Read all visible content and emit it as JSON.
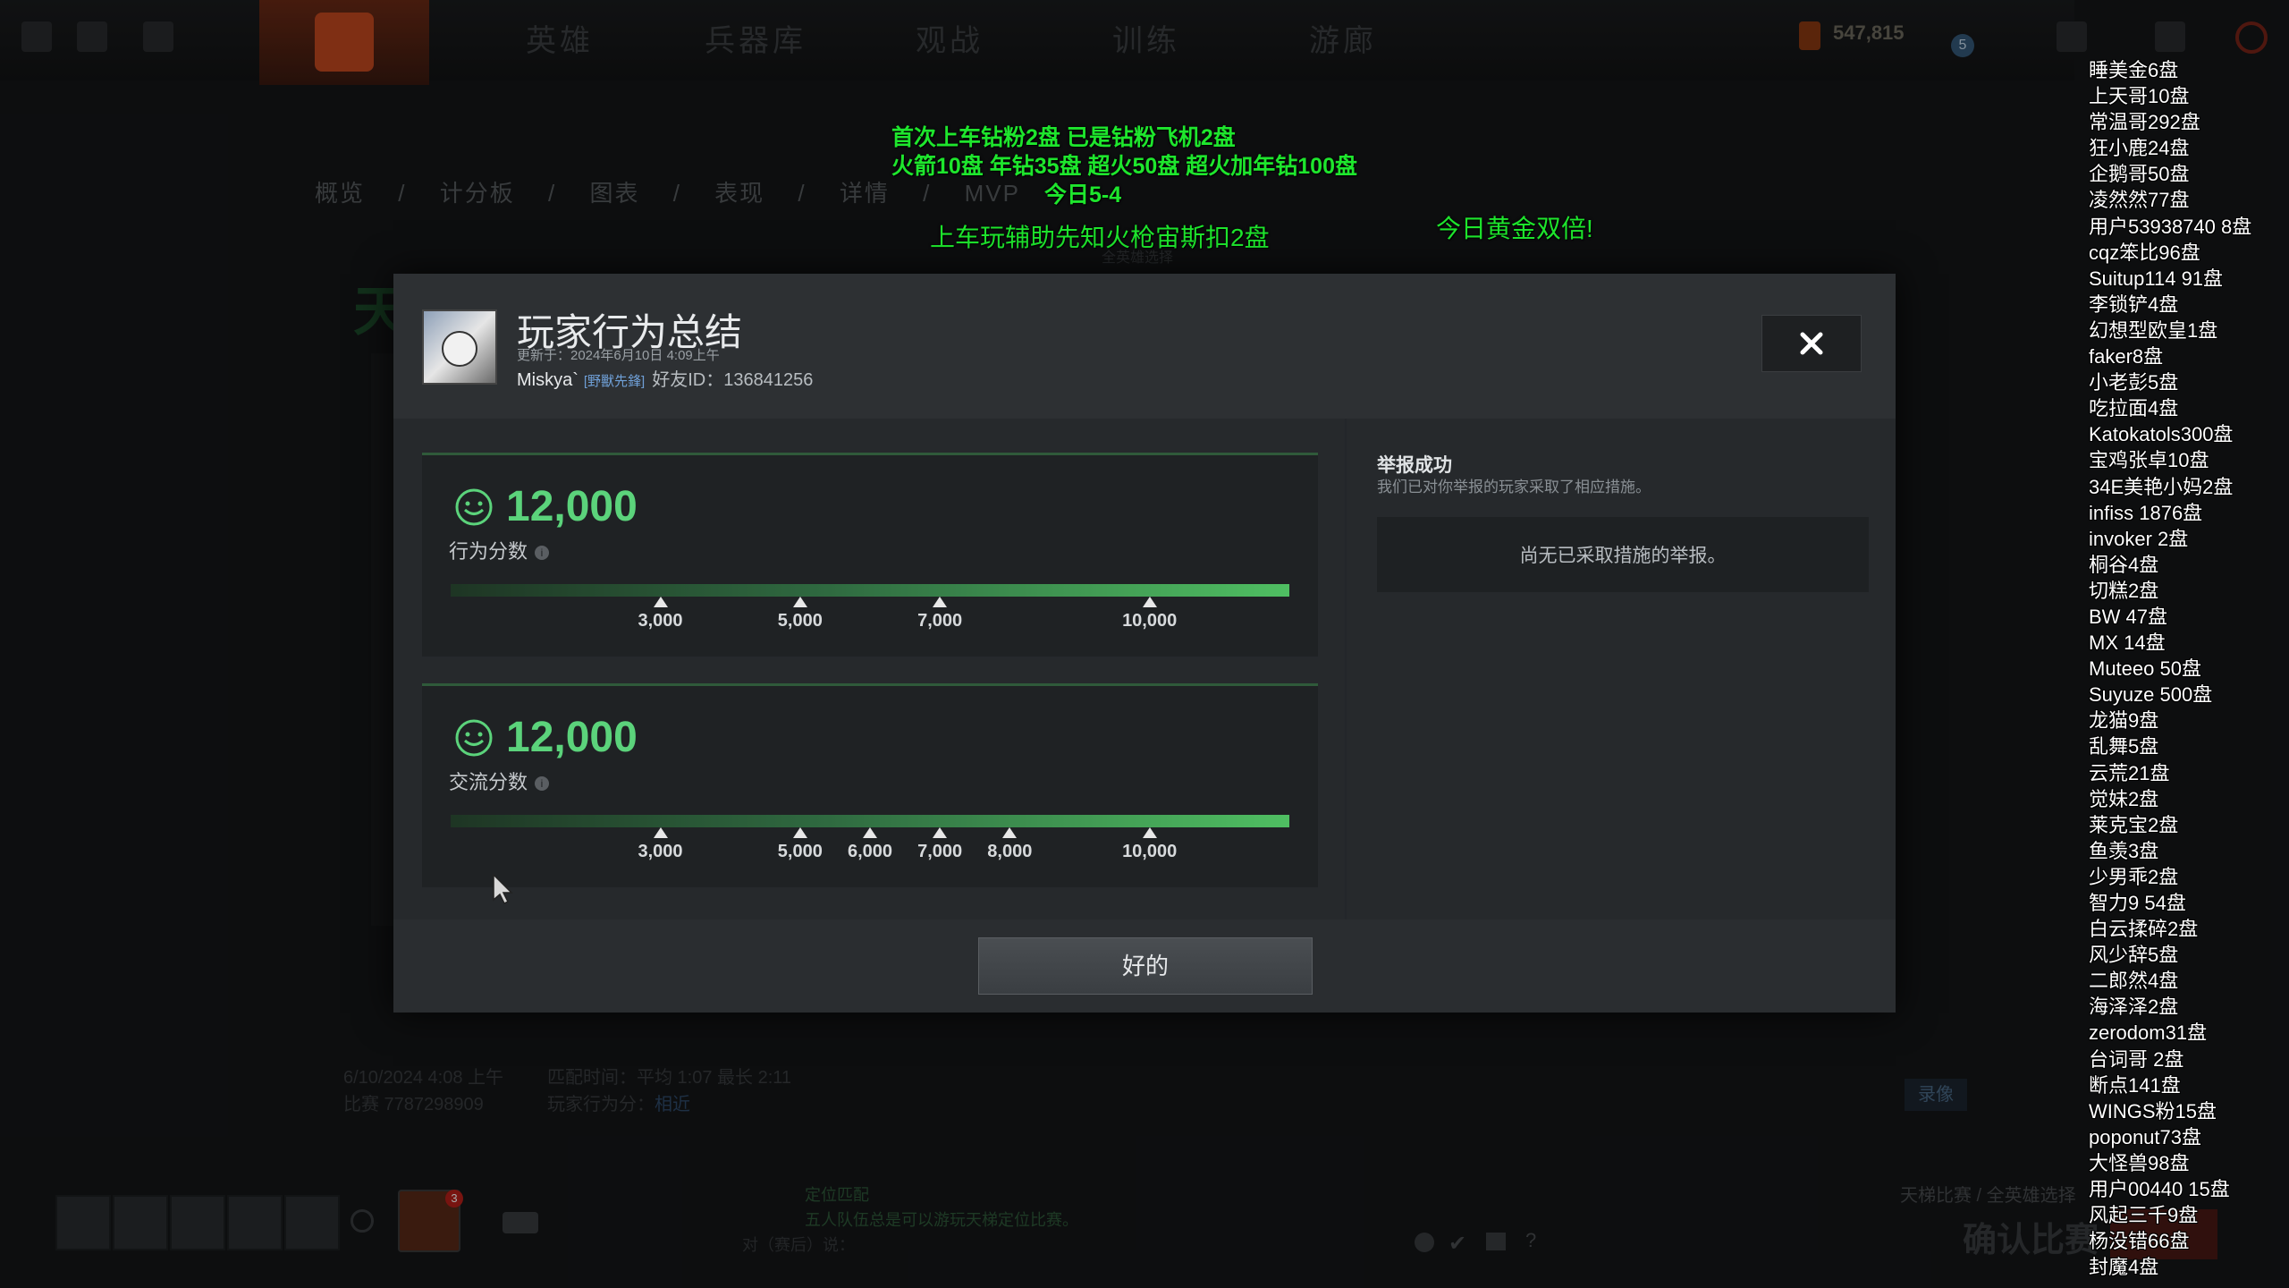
{
  "top_nav": {
    "items": [
      "英雄",
      "兵器库",
      "观战",
      "训练",
      "游廊"
    ],
    "currency": "547,815",
    "level": "5"
  },
  "sub_nav": {
    "items": [
      "概览",
      "/",
      "计分板",
      "/",
      "图表",
      "/",
      "表现",
      "/",
      "详情",
      "/",
      "MVP"
    ]
  },
  "background": {
    "date": "6/10/2024 4:08 上午",
    "match_id": "比赛 7787298909",
    "duration_label": "匹配时间：平均 1:07 最长 2:11",
    "behavior_label": "玩家行为分：",
    "behavior_value": "相近",
    "record_button": "录像",
    "queue_title": "定位匹配",
    "queue_desc": "五人队伍总是可以游玩天梯定位比赛。",
    "chat_prefix": "对（赛后）说：",
    "mode": "天梯比赛 / 全英雄选择",
    "confirm": "确认比赛",
    "hero_select_hint": "全英雄选择",
    "hero_badge": "3"
  },
  "promo": {
    "line1": "首次上车钻粉2盘 已是钻粉飞机2盘",
    "line2": "火箭10盘 年钻35盘 超火50盘 超火加年钻100盘",
    "line3": "今日5-4",
    "line4": "上车玩辅助先知火枪宙斯扣2盘",
    "line5": "今日黄金双倍!"
  },
  "dialog": {
    "title": "玩家行为总结",
    "updated": "更新于：2024年6月10日 4:09上午",
    "player_name": "Miskya`",
    "player_tag": "[野獸先鋒]",
    "friend_id": "好友ID：136841256",
    "behavior": {
      "score": "12,000",
      "label": "行为分数",
      "value": 12000,
      "ticks": [
        {
          "value": 3000,
          "label": "3,000"
        },
        {
          "value": 5000,
          "label": "5,000"
        },
        {
          "value": 7000,
          "label": "7,000"
        },
        {
          "value": 10000,
          "label": "10,000"
        }
      ]
    },
    "communication": {
      "score": "12,000",
      "label": "交流分数",
      "value": 12000,
      "ticks": [
        {
          "value": 3000,
          "label": "3,000"
        },
        {
          "value": 5000,
          "label": "5,000"
        },
        {
          "value": 6000,
          "label": "6,000"
        },
        {
          "value": 7000,
          "label": "7,000"
        },
        {
          "value": 8000,
          "label": "8,000"
        },
        {
          "value": 10000,
          "label": "10,000"
        }
      ]
    },
    "report": {
      "title": "举报成功",
      "desc": "我们已对你举报的玩家采取了相应措施。",
      "empty": "尚无已采取措施的举报。"
    },
    "ok_label": "好的"
  },
  "chat_list": [
    "睡美金6盘",
    "上天哥10盘",
    "常温哥292盘",
    "狂小鹿24盘",
    "企鹅哥50盘",
    "凌然然77盘",
    "用户53938740 8盘",
    "cqz笨比96盘",
    "Suitup114 91盘",
    "李锁铲4盘",
    "幻想型欧皇1盘",
    "faker8盘",
    "小老彭5盘",
    "吃拉面4盘",
    "Katokatols300盘",
    "宝鸡张卓10盘",
    "34E美艳小妈2盘",
    "infiss 1876盘",
    "invoker 2盘",
    "桐谷4盘",
    "切糕2盘",
    "BW 47盘",
    "MX 14盘",
    "Muteeo 50盘",
    "Suyuze 500盘",
    "龙猫9盘",
    "乱舞5盘",
    "云荒21盘",
    "觉妹2盘",
    "莱克宝2盘",
    "鱼羡3盘",
    "少男乖2盘",
    "智力9 54盘",
    "白云揉碎2盘",
    "风少辞5盘",
    "二郎然4盘",
    "海泽泽2盘",
    "zerodom31盘",
    "台词哥 2盘",
    "断点141盘",
    "WINGS粉15盘",
    "poponut73盘",
    "大怪兽98盘",
    "用户00440 15盘",
    "风起三千9盘",
    "杨没错66盘",
    "封魔4盘"
  ]
}
